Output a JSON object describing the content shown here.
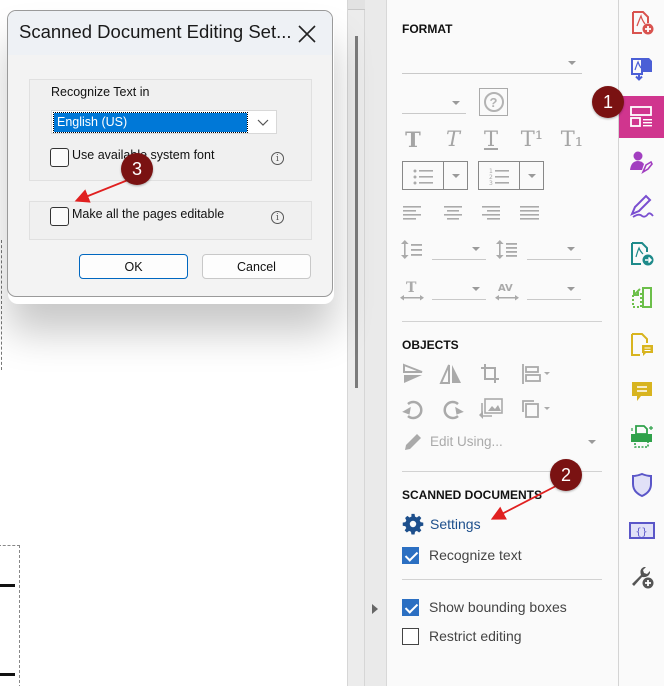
{
  "dialog": {
    "title": "Scanned Document Editing Set...",
    "recognize_label": "Recognize Text in",
    "language_selected": "English (US)",
    "use_system_font_label": "Use available system font",
    "use_system_font_checked": false,
    "make_editable_label": "Make all the pages editable",
    "make_editable_checked": false,
    "info_glyph": "i",
    "ok_label": "OK",
    "cancel_label": "Cancel"
  },
  "panel": {
    "format_title": "FORMAT",
    "text_style_glyphs": [
      "T",
      "T",
      "T",
      "T¹",
      "T₁"
    ],
    "help_glyph": "?",
    "objects_title": "OBJECTS",
    "edit_using_label": "Edit Using...",
    "scanned_title": "SCANNED DOCUMENTS",
    "settings_label": "Settings",
    "recognize_text_label": "Recognize text",
    "recognize_text_checked": true,
    "show_bounding_label": "Show bounding boxes",
    "show_bounding_checked": true,
    "restrict_editing_label": "Restrict editing",
    "restrict_editing_checked": false
  },
  "rail": {
    "items": [
      {
        "icon": "create-pdf-icon",
        "color": "#d9534f"
      },
      {
        "icon": "export-pdf-icon",
        "color": "#4b5fd6"
      },
      {
        "icon": "edit-pdf-icon",
        "color": "#ffffff",
        "active": true,
        "active_bg": "#d0358e"
      },
      {
        "icon": "request-signatures-icon",
        "color": "#a23fc0"
      },
      {
        "icon": "fill-sign-icon",
        "color": "#7a4fd0"
      },
      {
        "icon": "share-icon",
        "color": "#1e8a8a"
      },
      {
        "icon": "organize-pages-icon",
        "color": "#6cbf4a"
      },
      {
        "icon": "comment-file-icon",
        "color": "#d8b41f"
      },
      {
        "icon": "comment-icon",
        "color": "#d8b41f"
      },
      {
        "icon": "print-production-icon",
        "color": "#2fa14a"
      },
      {
        "icon": "protect-icon",
        "color": "#5a56c8"
      },
      {
        "icon": "javascript-icon",
        "color": "#5a56c8"
      },
      {
        "icon": "more-tools-icon",
        "color": "#555555"
      }
    ]
  },
  "annotations": {
    "badge_1": "1",
    "badge_2": "2",
    "badge_3": "3",
    "badge_color": "#7a1212",
    "arrow_color": "#e02020"
  }
}
